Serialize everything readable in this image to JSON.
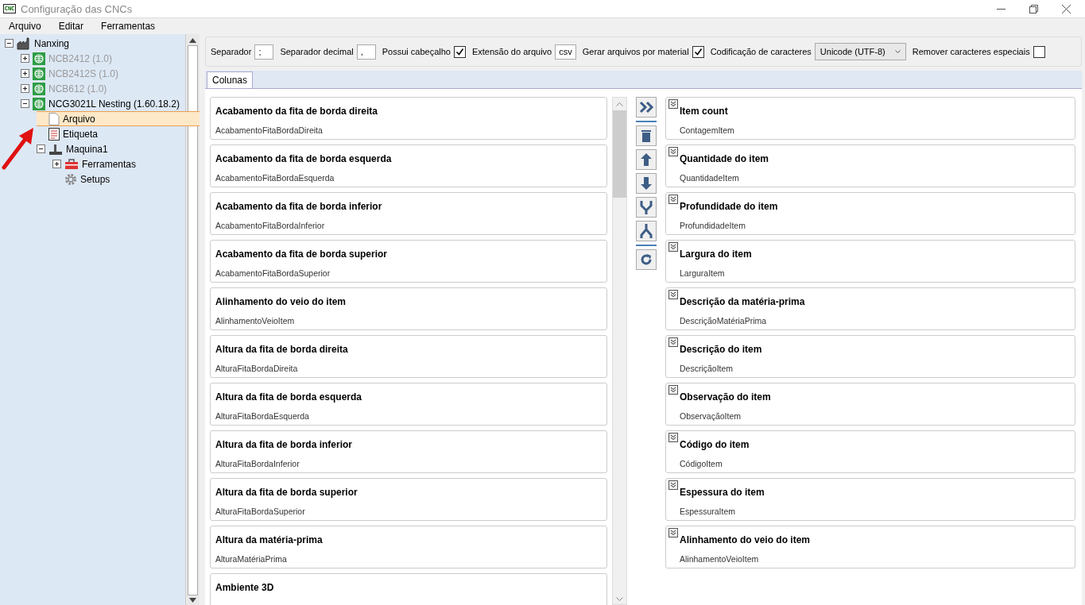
{
  "window": {
    "title": "Configuração das CNCs",
    "app_icon": "CNC"
  },
  "menu": [
    "Arquivo",
    "Editar",
    "Ferramentas"
  ],
  "tree": [
    {
      "label": "Nanxing",
      "kind": "factory",
      "expanded": true,
      "selected": false,
      "disabled": false,
      "children": [
        {
          "label": "NCB2412 (1.0)",
          "kind": "cnc",
          "expanded": false,
          "selected": false,
          "disabled": true
        },
        {
          "label": "NCB2412S (1.0)",
          "kind": "cnc",
          "expanded": false,
          "selected": false,
          "disabled": true
        },
        {
          "label": "NCB612 (1.0)",
          "kind": "cnc",
          "expanded": false,
          "selected": false,
          "disabled": true
        },
        {
          "label": "NCG3021L Nesting (1.60.18.2)",
          "kind": "cnc",
          "expanded": true,
          "selected": false,
          "disabled": false,
          "children": [
            {
              "label": "Arquivo",
              "kind": "file",
              "selected": true,
              "disabled": false
            },
            {
              "label": "Etiqueta",
              "kind": "label",
              "selected": false,
              "disabled": false
            },
            {
              "label": "Maquina1",
              "kind": "machine",
              "expanded": true,
              "selected": false,
              "disabled": false,
              "children": [
                {
                  "label": "Ferramentas",
                  "kind": "toolbox",
                  "expanded": false,
                  "selected": false,
                  "disabled": false
                },
                {
                  "label": "Setups",
                  "kind": "gear",
                  "selected": false,
                  "disabled": false
                }
              ]
            }
          ]
        }
      ]
    }
  ],
  "options": [
    {
      "kind": "text",
      "label": "Separador",
      "value": ";"
    },
    {
      "kind": "text",
      "label": "Separador decimal",
      "value": ","
    },
    {
      "kind": "checkbox",
      "label": "Possui cabeçalho",
      "checked": true
    },
    {
      "kind": "text",
      "label": "Extensão do arquivo",
      "value": "csv"
    },
    {
      "kind": "checkbox",
      "label": "Gerar arquivos por material",
      "checked": true
    },
    {
      "kind": "select",
      "label": "Codificação de caracteres",
      "value": "Unicode (UTF-8)"
    },
    {
      "kind": "checkbox",
      "label": "Remover caracteres especiais",
      "checked": false
    }
  ],
  "tabs": [
    {
      "label": "Colunas",
      "selected": true
    }
  ],
  "available_columns": [
    {
      "title": "Acabamento da fita de borda direita",
      "field": "AcabamentoFitaBordaDireita"
    },
    {
      "title": "Acabamento da fita de borda esquerda",
      "field": "AcabamentoFitaBordaEsquerda"
    },
    {
      "title": "Acabamento da fita de borda inferior",
      "field": "AcabamentoFitaBordaInferior"
    },
    {
      "title": "Acabamento da fita de borda superior",
      "field": "AcabamentoFitaBordaSuperior"
    },
    {
      "title": "Alinhamento do veio do item",
      "field": "AlinhamentoVeioItem"
    },
    {
      "title": "Altura da fita de borda direita",
      "field": "AlturaFitaBordaDireita"
    },
    {
      "title": "Altura da fita de borda esquerda",
      "field": "AlturaFitaBordaEsquerda"
    },
    {
      "title": "Altura da fita de borda inferior",
      "field": "AlturaFitaBordaInferior"
    },
    {
      "title": "Altura da fita de borda superior",
      "field": "AlturaFitaBordaSuperior"
    },
    {
      "title": "Altura da matéria-prima",
      "field": "AlturaMatériaPrima"
    },
    {
      "title": "Ambiente 3D"
    }
  ],
  "selected_columns": [
    {
      "title": "Item count",
      "field": "ContagemItem"
    },
    {
      "title": "Quantidade do item",
      "field": "QuantidadeItem"
    },
    {
      "title": "Profundidade do item",
      "field": "ProfundidadeItem"
    },
    {
      "title": "Largura do item",
      "field": "LarguraItem"
    },
    {
      "title": "Descrição da matéria-prima",
      "field": "DescriçãoMatériaPrima"
    },
    {
      "title": "Descrição do item",
      "field": "DescriçãoItem"
    },
    {
      "title": "Observação do item",
      "field": "ObservaçãoItem"
    },
    {
      "title": "Código do item",
      "field": "CódigoItem"
    },
    {
      "title": "Espessura do item",
      "field": "EspessuraItem"
    },
    {
      "title": "Alinhamento do veio do item",
      "field": "AlinhamentoVeioItem"
    }
  ]
}
